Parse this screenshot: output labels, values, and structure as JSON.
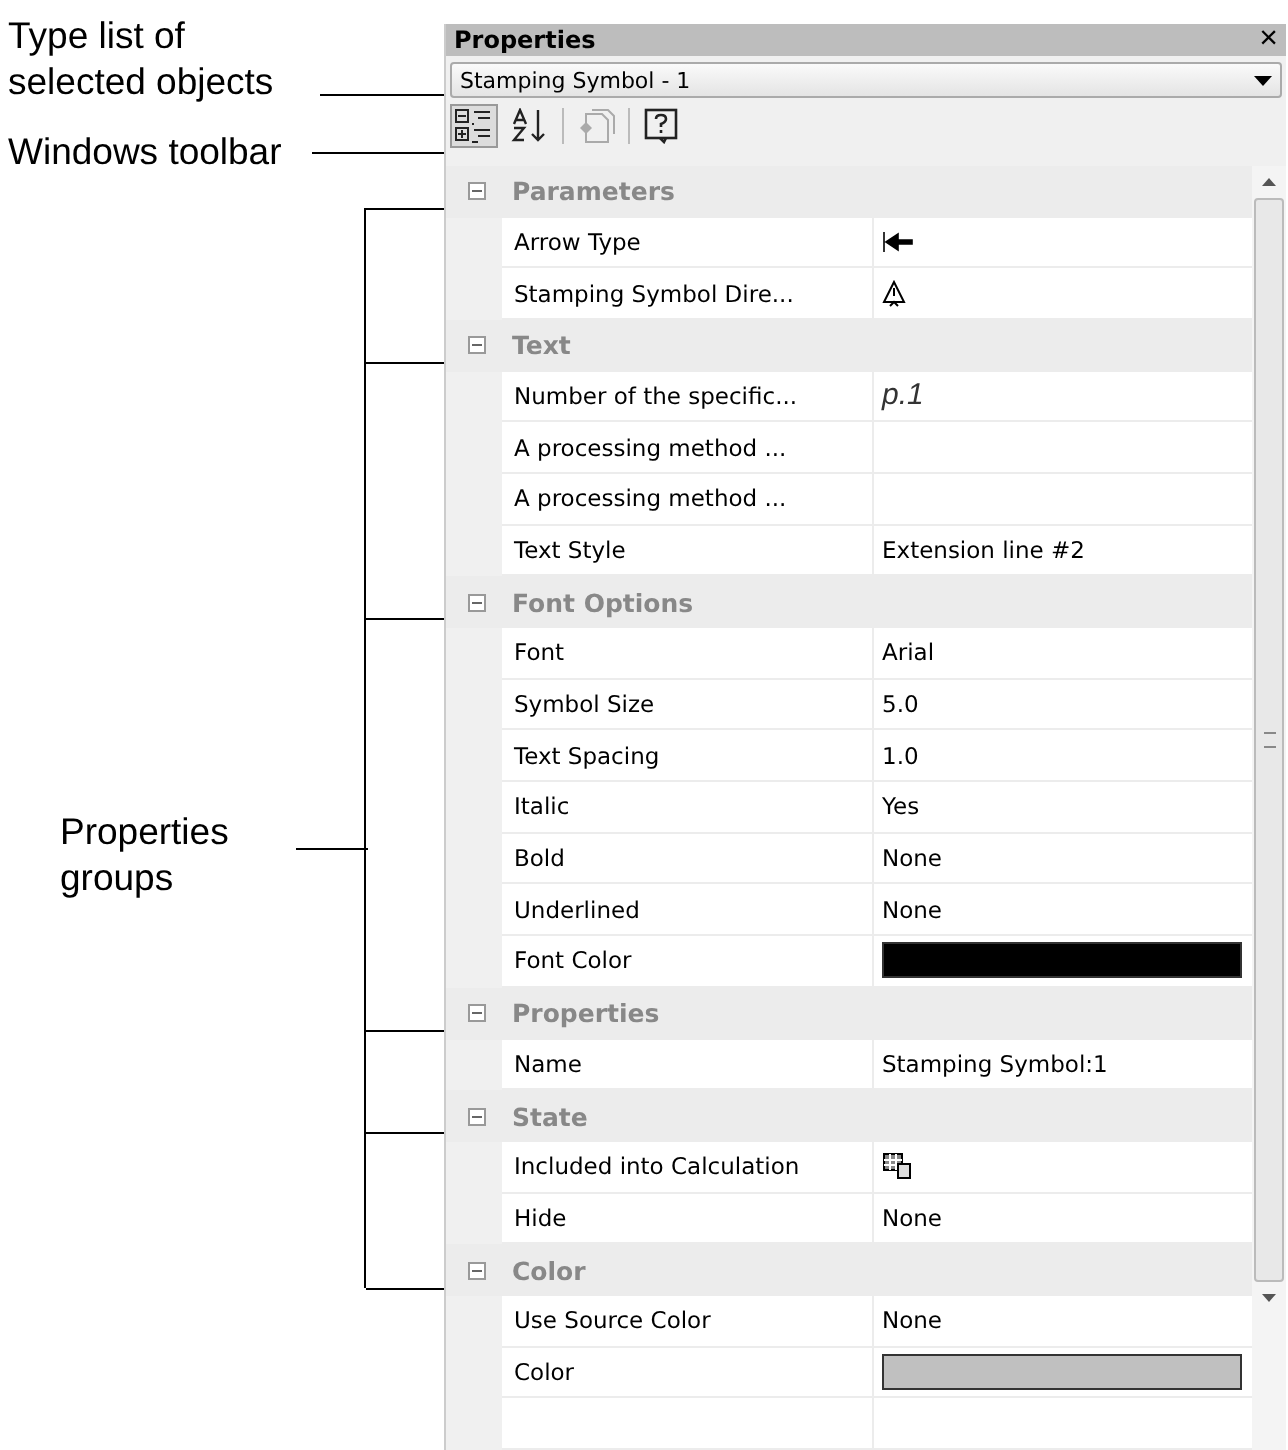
{
  "annotations": [
    {
      "kind": "dropdown",
      "text": "Type list of selected objects"
    },
    {
      "kind": "toolbar",
      "text": "Windows toolbar"
    },
    {
      "kind": "groups",
      "text": "Properties groups"
    }
  ],
  "panel": {
    "title": "Properties",
    "close": "×",
    "object_type": "Stamping Symbol - 1",
    "toolbar": [
      {
        "kind": "categorized",
        "selected": true,
        "disabled": false
      },
      {
        "kind": "alphabetical",
        "selected": false,
        "disabled": false
      },
      {
        "kind": "pages",
        "selected": false,
        "disabled": true
      },
      {
        "kind": "help",
        "selected": false,
        "disabled": false
      }
    ],
    "groups": [
      {
        "name": "Parameters",
        "expanded": true,
        "rows": [
          {
            "name": "Arrow Type",
            "kind": "arrow-icon"
          },
          {
            "name": "Stamping Symbol Dire...",
            "kind": "direction-icon"
          }
        ]
      },
      {
        "name": "Text",
        "expanded": true,
        "rows": [
          {
            "name": "Number of the specific...",
            "kind": "italic",
            "value": "p.1"
          },
          {
            "name": "A processing method ...",
            "kind": "text"
          },
          {
            "name": "A processing method ...",
            "kind": "text"
          },
          {
            "name": "Text Style",
            "kind": "text",
            "value": "Extension line #2"
          }
        ]
      },
      {
        "name": "Font Options",
        "expanded": true,
        "rows": [
          {
            "name": "Font",
            "kind": "text",
            "value": "Arial"
          },
          {
            "name": "Symbol Size",
            "kind": "text",
            "value": "5.0"
          },
          {
            "name": "Text Spacing",
            "kind": "text",
            "value": "1.0"
          },
          {
            "name": "Italic",
            "kind": "text",
            "value": "Yes"
          },
          {
            "name": "Bold",
            "kind": "text",
            "value": "None"
          },
          {
            "name": "Underlined",
            "kind": "text",
            "value": "None"
          },
          {
            "name": "Font Color",
            "kind": "color",
            "color": "#000000"
          }
        ]
      },
      {
        "name": "Properties",
        "expanded": true,
        "rows": [
          {
            "name": "Name",
            "kind": "text",
            "value": "Stamping Symbol:1"
          }
        ]
      },
      {
        "name": "State",
        "expanded": true,
        "rows": [
          {
            "name": "Included into Calculation",
            "kind": "calc-icon"
          },
          {
            "name": "Hide",
            "kind": "text",
            "value": "None"
          }
        ]
      },
      {
        "name": "Color",
        "expanded": true,
        "rows": [
          {
            "name": "Use Source Color",
            "kind": "text",
            "value": "None"
          },
          {
            "name": "Color",
            "kind": "color",
            "color": "#c0c0c0"
          }
        ]
      }
    ]
  }
}
